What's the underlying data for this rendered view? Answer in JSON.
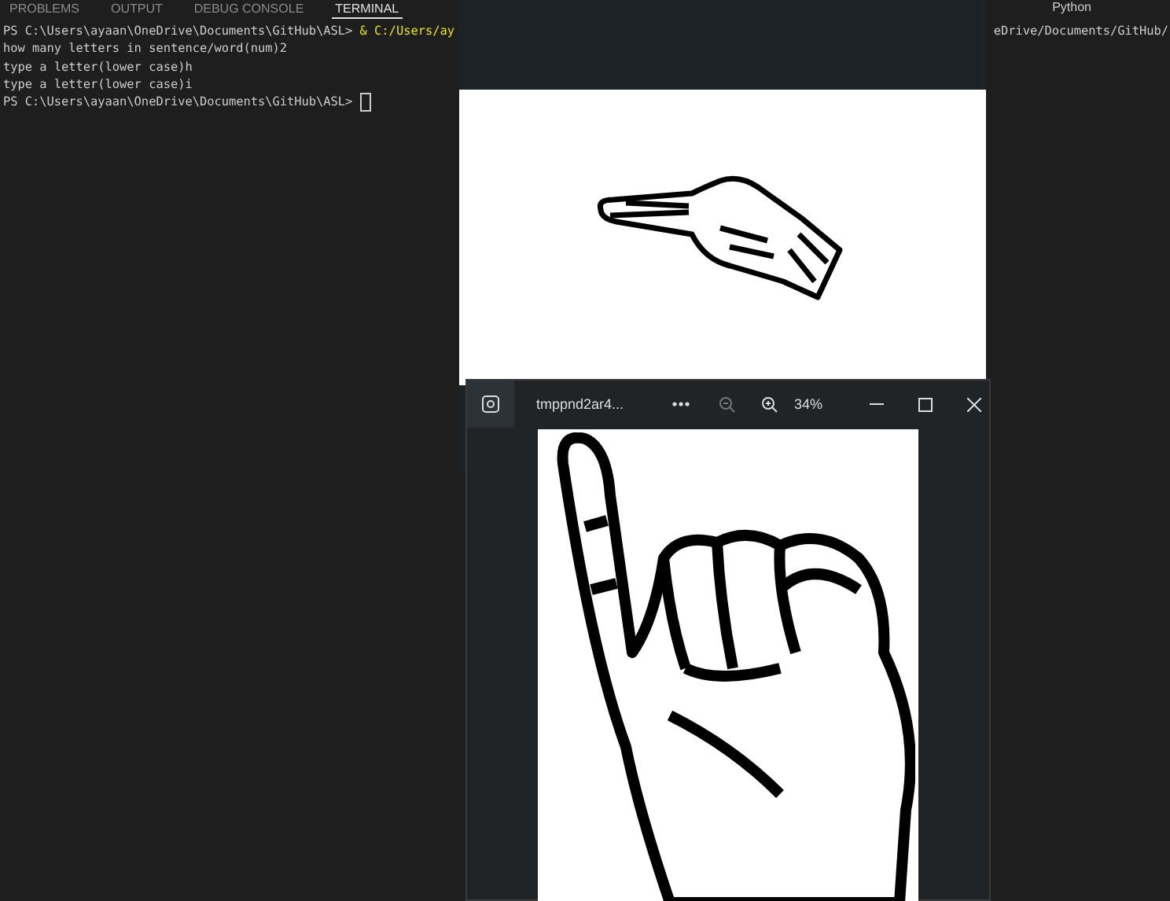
{
  "panel_tabs": [
    {
      "label": "PROBLEMS",
      "selected": false
    },
    {
      "label": "OUTPUT",
      "selected": false
    },
    {
      "label": "DEBUG CONSOLE",
      "selected": false
    },
    {
      "label": "TERMINAL",
      "selected": true
    }
  ],
  "terminal_profile": "Python",
  "terminal_lines": [
    {
      "prompt": "PS C:\\Users\\ayaan\\OneDrive\\Documents\\GitHub\\ASL> ",
      "command": "& C:/Users/ay"
    },
    {
      "prompt": "how many letters in sentence/word(num)2"
    },
    {
      "prompt": "type a letter(lower case)h"
    },
    {
      "prompt": "type a letter(lower case)i"
    },
    {
      "prompt": "PS C:\\Users\\ayaan\\OneDrive\\Documents\\GitHub\\ASL> ",
      "cursor": true
    }
  ],
  "terminal_line_tail": "eDrive/Documents/GitHub/",
  "viewer_front": {
    "title": "tmppnd2ar4...",
    "zoom": "34%"
  }
}
